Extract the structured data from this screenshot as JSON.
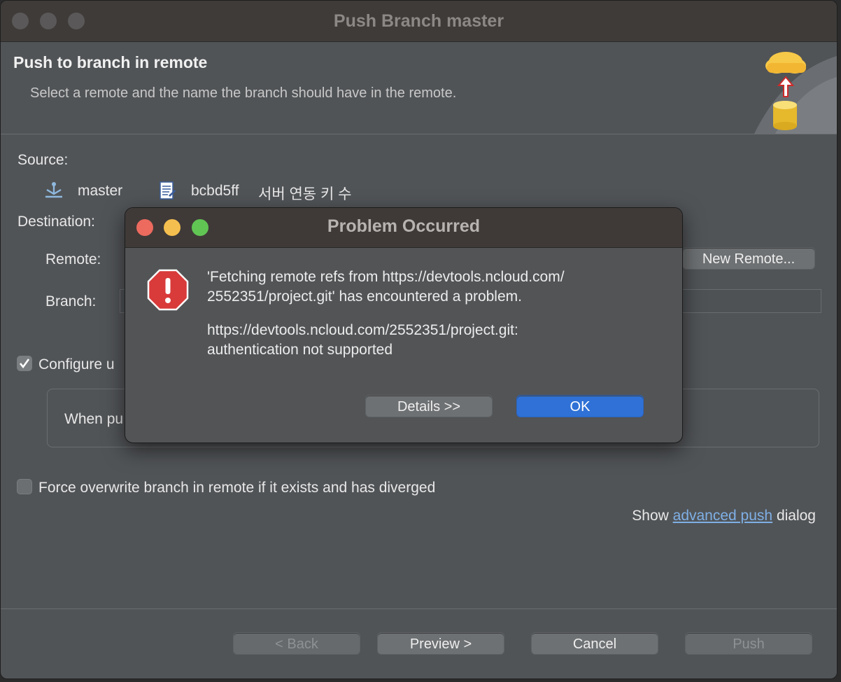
{
  "window": {
    "title": "Push Branch master",
    "header_title": "Push to branch in remote",
    "header_subtitle": "Select a remote and the name the branch should have in the remote."
  },
  "source": {
    "label": "Source:",
    "branch": "master",
    "commit_id": "bcbd5ff",
    "commit_message": "서버 연동 키 수"
  },
  "destination": {
    "label": "Destination:",
    "remote_label": "Remote:",
    "new_remote_button": "New Remote...",
    "branch_label": "Branch:"
  },
  "options": {
    "configure_label": "Configure u",
    "configure_checked": true,
    "when_pull_text": "When pu",
    "force_label": "Force overwrite branch in remote if it exists and has diverged",
    "force_checked": false,
    "show_prefix": "Show",
    "advanced_link": "advanced push",
    "show_suffix": "dialog"
  },
  "footer": {
    "back": "< Back",
    "preview": "Preview >",
    "cancel": "Cancel",
    "push": "Push"
  },
  "dialog": {
    "title": "Problem Occurred",
    "message_line1": "'Fetching remote refs from https://devtools.ncloud.com/",
    "message_line2": "2552351/project.git' has encountered a problem.",
    "detail_line1": "https://devtools.ncloud.com/2552351/project.git:",
    "detail_line2": "authentication not supported",
    "details_button": "Details >>",
    "ok_button": "OK"
  },
  "colors": {
    "traffic_red": "#ed6a5e",
    "traffic_yellow": "#f5bf4f",
    "traffic_green": "#61c554",
    "ok_blue": "#2f71d6",
    "link": "#7fb0e6"
  }
}
